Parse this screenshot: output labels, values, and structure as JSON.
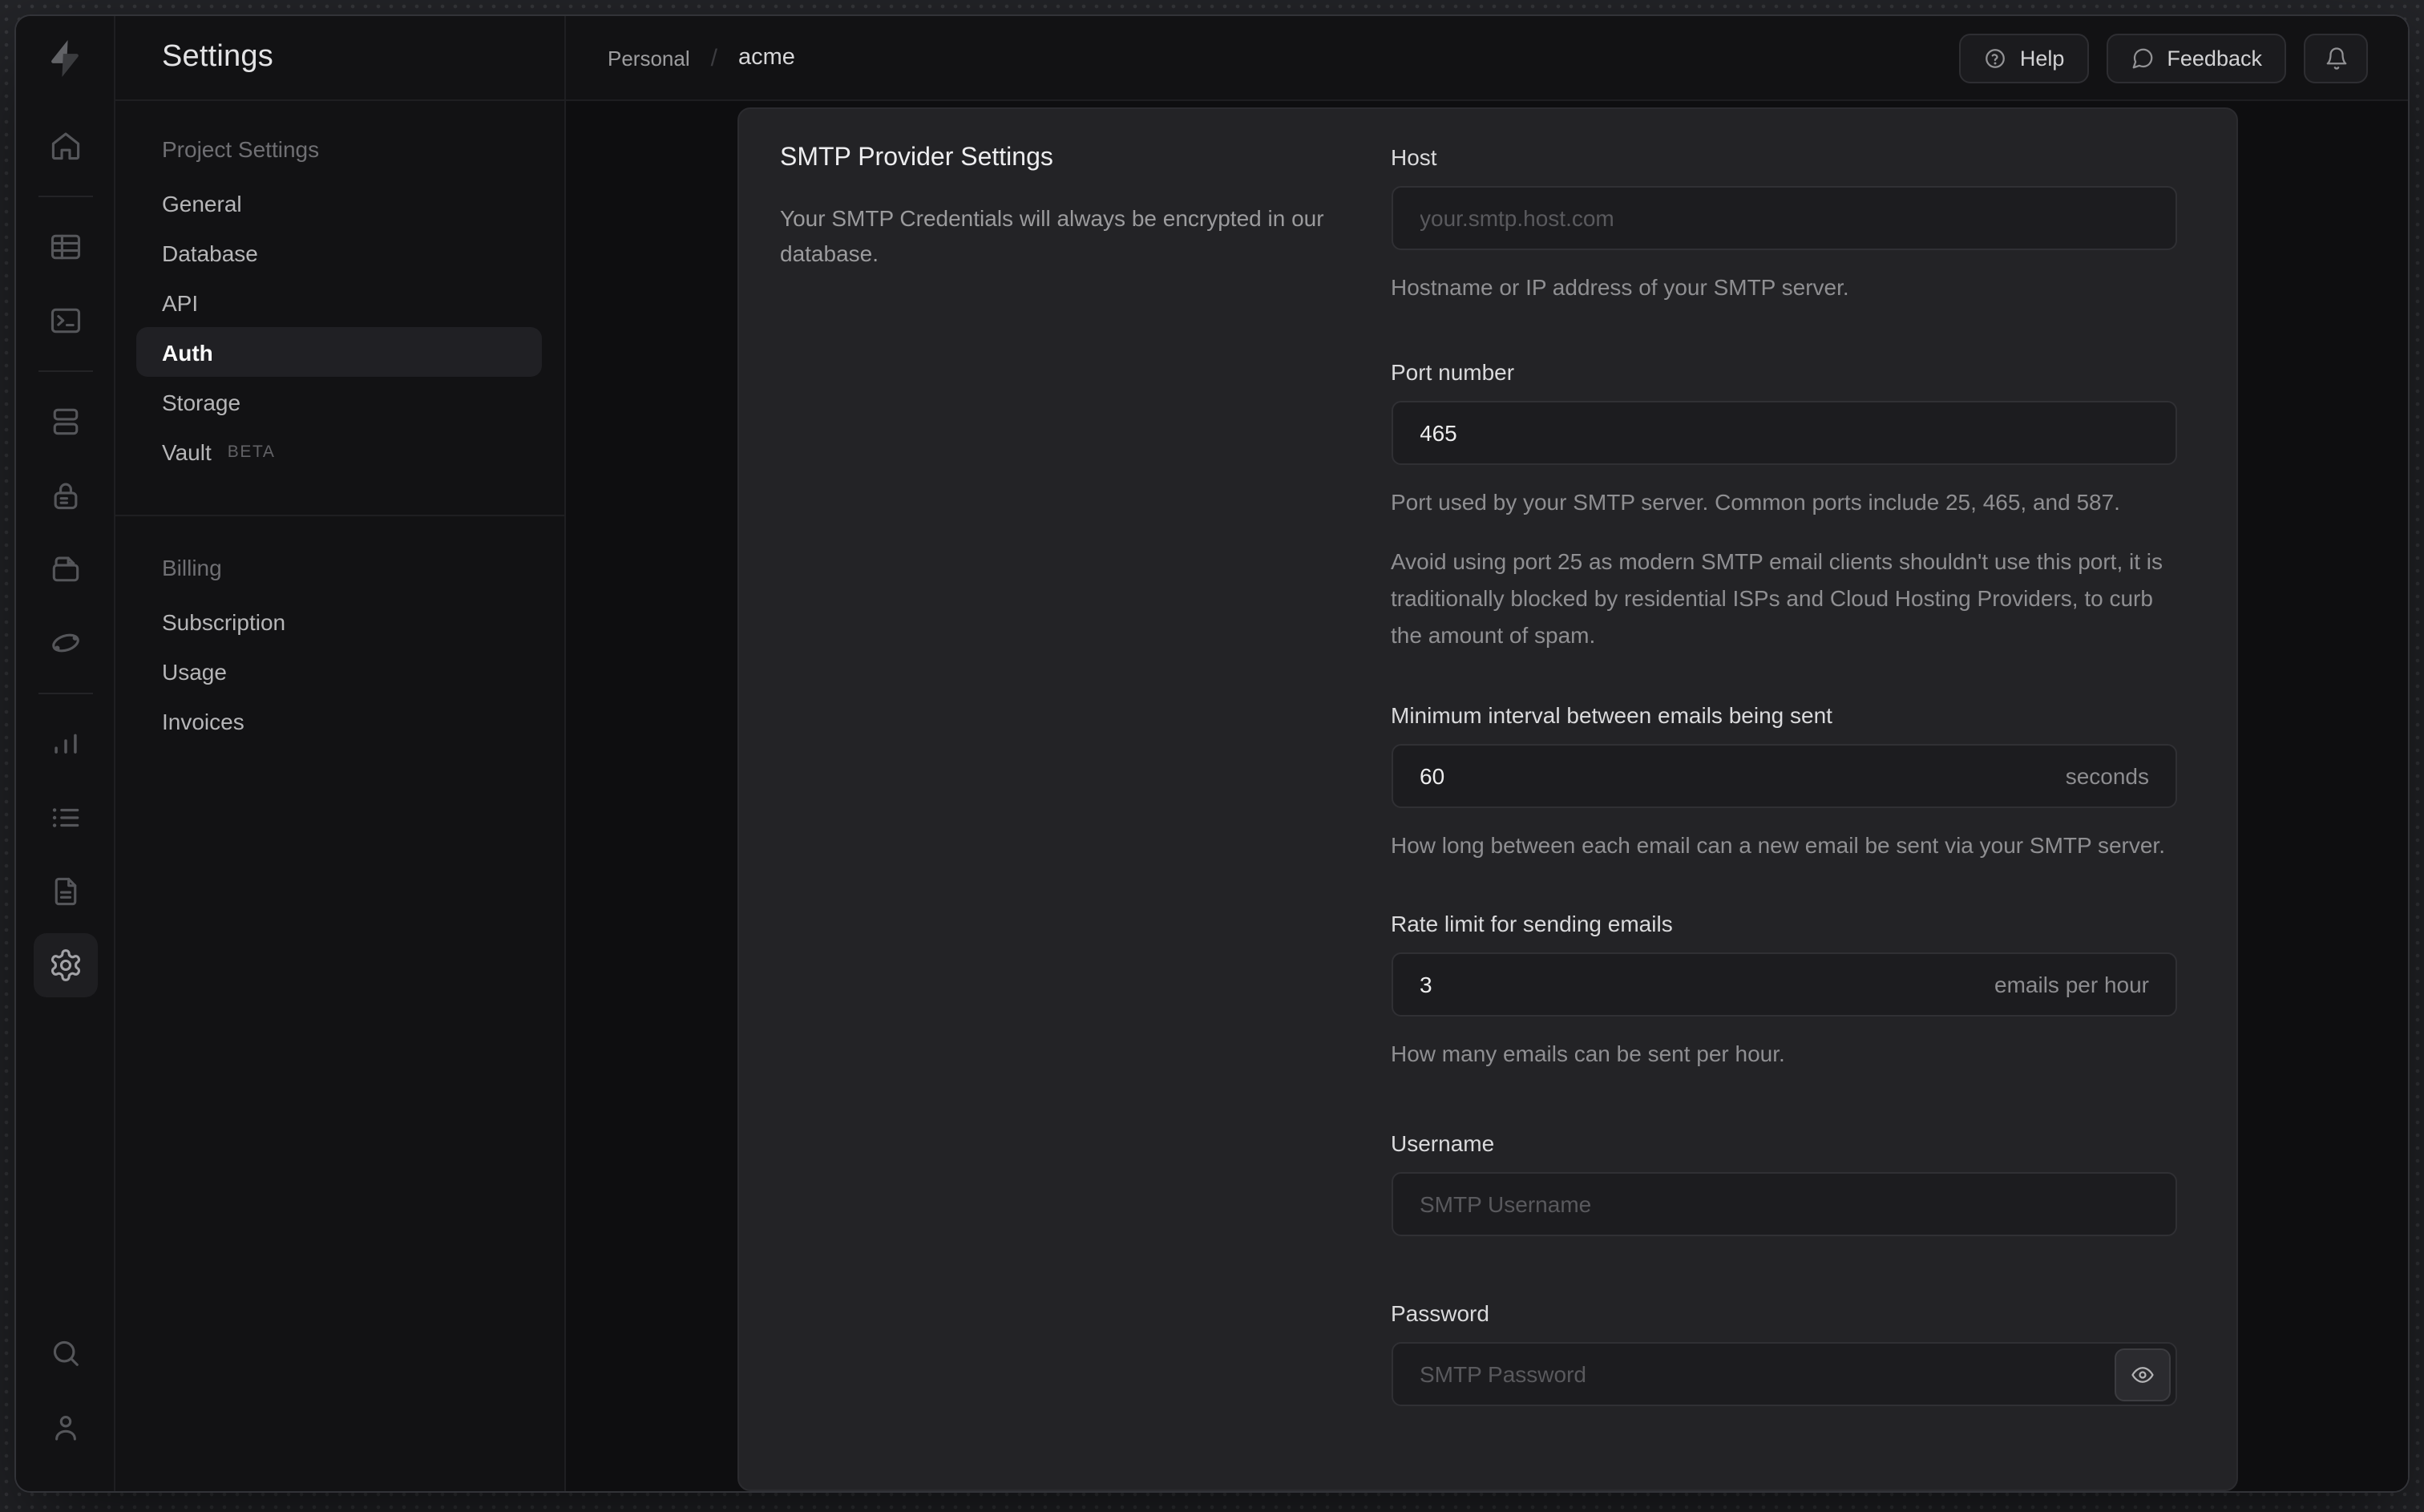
{
  "window_title": "Supabase project settings",
  "brand": {
    "logo_icon": "supabase-lightning-icon"
  },
  "rail": {
    "icons": [
      "home-icon",
      "table-editor-icon",
      "sql-editor-icon",
      "database-icon",
      "auth-lock-icon",
      "storage-icon",
      "edge-functions-icon",
      "reports-icon",
      "logs-icon",
      "docs-icon",
      "settings-gear-icon",
      "search-icon",
      "user-icon"
    ],
    "active_icon": "settings-gear-icon"
  },
  "sidebar": {
    "title": "Settings",
    "sections": [
      {
        "header": "Project Settings",
        "items": [
          {
            "label": "General"
          },
          {
            "label": "Database"
          },
          {
            "label": "API"
          },
          {
            "label": "Auth",
            "active": true
          },
          {
            "label": "Storage"
          },
          {
            "label": "Vault",
            "badge": "BETA"
          }
        ]
      },
      {
        "header": "Billing",
        "items": [
          {
            "label": "Subscription"
          },
          {
            "label": "Usage"
          },
          {
            "label": "Invoices"
          }
        ]
      }
    ]
  },
  "topbar": {
    "breadcrumb": {
      "org": "Personal",
      "separator": "/",
      "project": "acme"
    },
    "help_label": "Help",
    "feedback_label": "Feedback",
    "icons": [
      "help-icon",
      "feedback-icon",
      "bell-icon"
    ]
  },
  "smtp": {
    "title": "SMTP Provider Settings",
    "description": "Your SMTP Credentials will always be encrypted in our database.",
    "fields": {
      "host": {
        "label": "Host",
        "placeholder": "your.smtp.host.com",
        "helper": "Hostname or IP address of your SMTP server."
      },
      "port": {
        "label": "Port number",
        "value": "465",
        "helper": "Port used by your SMTP server. Common ports include 25, 465, and 587.",
        "note": "Avoid using port 25 as modern SMTP email clients shouldn't use this port, it is traditionally blocked by residential ISPs and Cloud Hosting Providers, to curb the amount of spam."
      },
      "interval": {
        "label": "Minimum interval between emails being sent",
        "value": "60",
        "unit": "seconds",
        "helper": "How long between each email can a new email be sent via your SMTP server."
      },
      "rate": {
        "label": "Rate limit for sending emails",
        "value": "3",
        "unit": "emails per hour",
        "helper": "How many emails can be sent per hour."
      },
      "username": {
        "label": "Username",
        "placeholder": "SMTP Username"
      },
      "password": {
        "label": "Password",
        "placeholder": "SMTP Password",
        "eye_icon": "eye-icon"
      }
    }
  },
  "colors": {
    "outer_background": "#242529",
    "window_background": "#121214",
    "content_background": "#0e0e10",
    "card_background": "#232326",
    "input_background": "#1c1c1f",
    "input_border": "#303034",
    "active_pill": "#202024",
    "text_primary": "#ededee",
    "text_muted": "#8f8f92"
  }
}
